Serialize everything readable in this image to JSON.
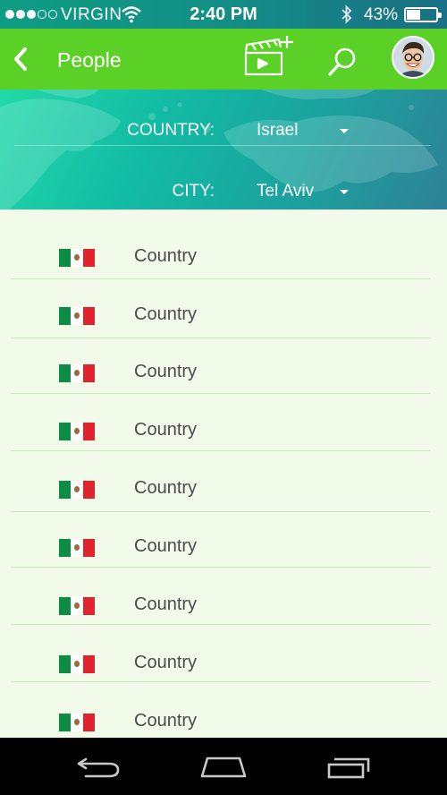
{
  "status_bar": {
    "carrier": "VIRGIN",
    "time": "2:40 PM",
    "battery_percent": "43%",
    "battery_level": 0.43
  },
  "app_bar": {
    "title": "People",
    "back_icon": "chevron-left-icon",
    "actions": [
      "clapperboard-add-icon",
      "search-icon",
      "avatar"
    ]
  },
  "filters": {
    "country": {
      "label": "COUNTRY:",
      "value": "Israel"
    },
    "city": {
      "label": "CITY:",
      "value": "Tel Aviv"
    }
  },
  "list": {
    "items": [
      {
        "flag": "mexico-flag-icon",
        "name": "Country"
      },
      {
        "flag": "mexico-flag-icon",
        "name": "Country"
      },
      {
        "flag": "mexico-flag-icon",
        "name": "Country"
      },
      {
        "flag": "mexico-flag-icon",
        "name": "Country"
      },
      {
        "flag": "mexico-flag-icon",
        "name": "Country"
      },
      {
        "flag": "mexico-flag-icon",
        "name": "Country"
      },
      {
        "flag": "mexico-flag-icon",
        "name": "Country"
      },
      {
        "flag": "mexico-flag-icon",
        "name": "Country"
      },
      {
        "flag": "mexico-flag-icon",
        "name": "Country"
      }
    ]
  },
  "colors": {
    "app_bar": "#5bd127",
    "list_background": "#f2fbea",
    "divider": "#cde8bd",
    "text": "#4a4a4a"
  }
}
